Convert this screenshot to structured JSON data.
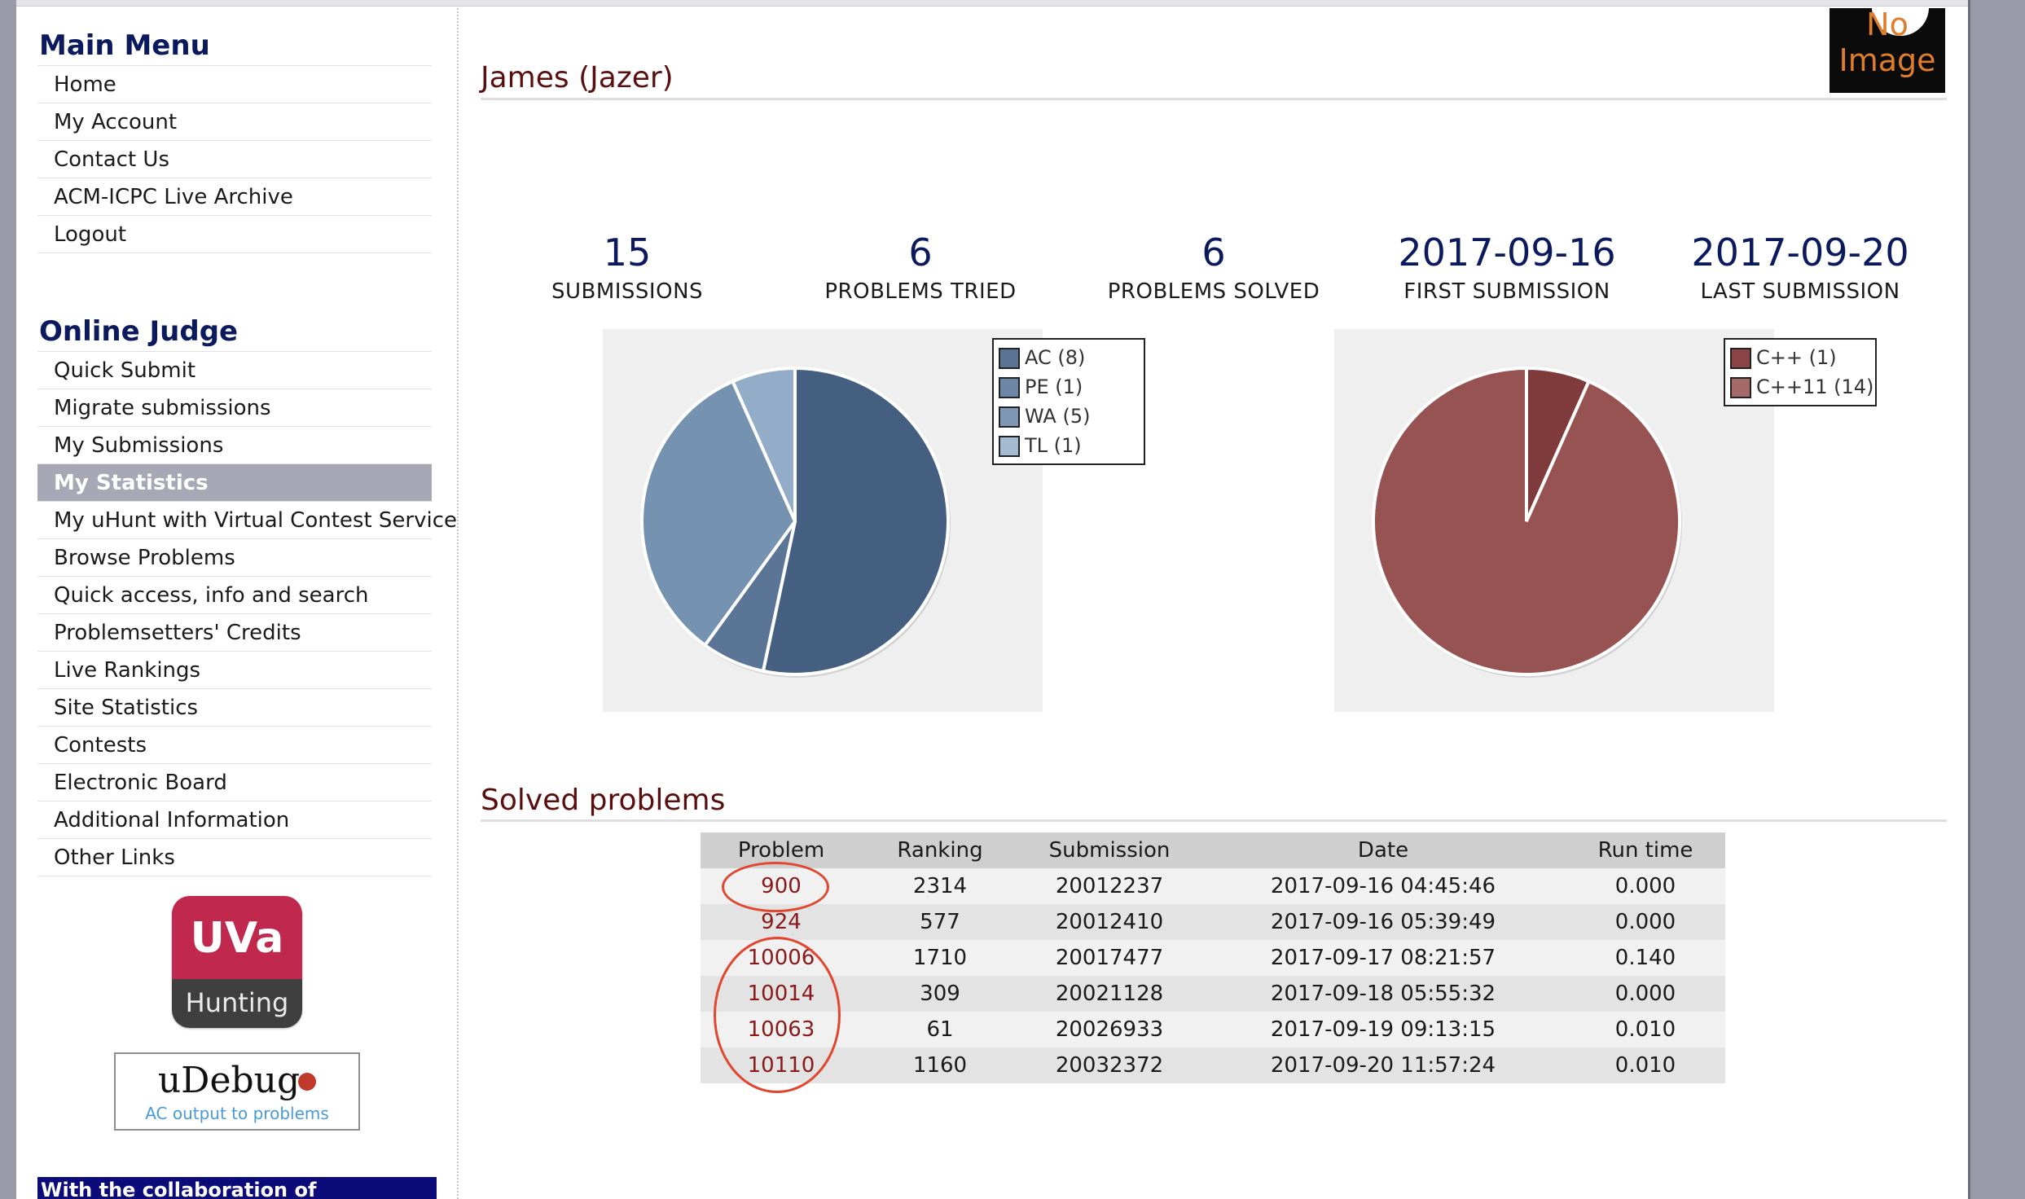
{
  "sidebar": {
    "main_menu_heading": "Main Menu",
    "main_menu_items": [
      "Home",
      "My Account",
      "Contact Us",
      "ACM-ICPC Live Archive",
      "Logout"
    ],
    "online_judge_heading": "Online Judge",
    "online_judge_items": [
      "Quick Submit",
      "Migrate submissions",
      "My Submissions",
      "My Statistics",
      "My uHunt with Virtual Contest Service",
      "Browse Problems",
      "Quick access, info and search",
      "Problemsetters' Credits",
      "Live Rankings",
      "Site Statistics",
      "Contests",
      "Electronic Board",
      "Additional Information",
      "Other Links"
    ],
    "active_item": "My Statistics",
    "uva_badge": {
      "top": "UVa",
      "bottom": "Hunting"
    },
    "udebug": {
      "logo": "uDebug",
      "subtitle": "AC output to problems"
    },
    "collab_text": "With the collaboration of"
  },
  "profile": {
    "title": "James (Jazer)",
    "avatar_text_line1": "No",
    "avatar_text_line2": "Image"
  },
  "stats": [
    {
      "value": "15",
      "label": "SUBMISSIONS"
    },
    {
      "value": "6",
      "label": "PROBLEMS TRIED"
    },
    {
      "value": "6",
      "label": "PROBLEMS SOLVED"
    },
    {
      "value": "2017-09-16",
      "label": "FIRST SUBMISSION"
    },
    {
      "value": "2017-09-20",
      "label": "LAST SUBMISSION"
    }
  ],
  "charts": {
    "verdicts": {
      "legend": [
        "AC (8)",
        "PE (1)",
        "WA (5)",
        "TL (1)"
      ],
      "values": [
        8,
        1,
        5,
        1
      ],
      "colors": [
        "#445f80",
        "#5a7596",
        "#7592b0",
        "#93acc7"
      ]
    },
    "languages": {
      "legend": [
        "C++ (1)",
        "C++11 (14)"
      ],
      "values": [
        1,
        14
      ],
      "colors": [
        "#7f3a3c",
        "#965352"
      ]
    }
  },
  "solved": {
    "title": "Solved problems",
    "columns": [
      "Problem",
      "Ranking",
      "Submission",
      "Date",
      "Run time"
    ],
    "rows": [
      [
        "900",
        "2314",
        "20012237",
        "2017-09-16 04:45:46",
        "0.000"
      ],
      [
        "924",
        "577",
        "20012410",
        "2017-09-16 05:39:49",
        "0.000"
      ],
      [
        "10006",
        "1710",
        "20017477",
        "2017-09-17 08:21:57",
        "0.140"
      ],
      [
        "10014",
        "309",
        "20021128",
        "2017-09-18 05:55:32",
        "0.000"
      ],
      [
        "10063",
        "61",
        "20026933",
        "2017-09-19 09:13:15",
        "0.010"
      ],
      [
        "10110",
        "1160",
        "20032372",
        "2017-09-20 11:57:24",
        "0.010"
      ]
    ]
  },
  "colors": {
    "heading_navy": "#0b1a5c",
    "title_maroon": "#5a0f0f",
    "annotation_red": "#e0472e",
    "active_bg": "#a7a7b6"
  }
}
